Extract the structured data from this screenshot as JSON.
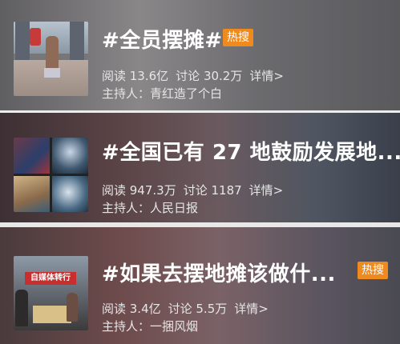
{
  "topics": [
    {
      "title": "#全员摆摊#",
      "badge": "热搜",
      "reads": "阅读 13.6亿",
      "discussions": "讨论 30.2万",
      "details": "详情>",
      "host": "主持人：青红造了个白"
    },
    {
      "title": "#全国已有 27 地鼓励发展地...",
      "badge": "",
      "reads": "阅读 947.3万",
      "discussions": "讨论 1187",
      "details": "详情>",
      "host": "主持人：人民日报"
    },
    {
      "title": "#如果去摆地摊该做什...",
      "badge": "热搜",
      "reads": "阅读 3.4亿",
      "discussions": "讨论 5.5万",
      "details": "详情>",
      "host": "主持人：一捆风烟",
      "thumb_sign": "自媒体转行"
    }
  ],
  "colors": {
    "badge": "#ef8a1f",
    "separator": "#ececec"
  }
}
